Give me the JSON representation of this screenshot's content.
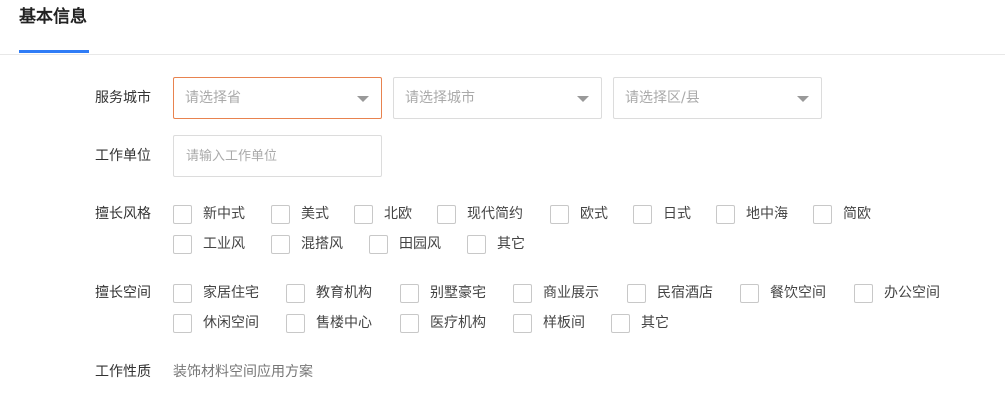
{
  "header": {
    "title": "基本信息"
  },
  "form": {
    "city": {
      "label": "服务城市",
      "province_placeholder": "请选择省",
      "city_placeholder": "请选择城市",
      "district_placeholder": "请选择区/县"
    },
    "work_unit": {
      "label": "工作单位",
      "placeholder": "请输入工作单位"
    },
    "styles": {
      "label": "擅长风格",
      "options": [
        "新中式",
        "美式",
        "北欧",
        "现代简约",
        "欧式",
        "日式",
        "地中海",
        "简欧",
        "工业风",
        "混搭风",
        "田园风",
        "其它"
      ]
    },
    "spaces": {
      "label": "擅长空间",
      "options": [
        "家居住宅",
        "教育机构",
        "别墅豪宅",
        "商业展示",
        "民宿酒店",
        "餐饮空间",
        "办公空间",
        "休闲空间",
        "售楼中心",
        "医疗机构",
        "样板间",
        "其它"
      ]
    },
    "work_nature": {
      "label": "工作性质",
      "value": "装饰材料空间应用方案"
    }
  },
  "colors": {
    "accent": "#2f7cf6",
    "active_border": "#e8834f"
  }
}
